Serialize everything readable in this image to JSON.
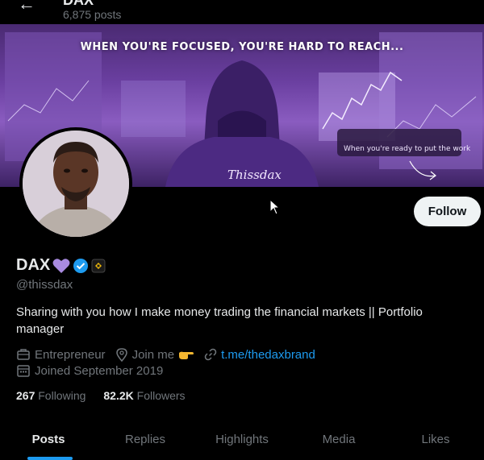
{
  "header": {
    "name": "DAX",
    "posts_count": "6,875 posts"
  },
  "banner": {
    "quote": "WHEN YOU'RE FOCUSED, YOU'RE HARD TO REACH...",
    "note": "When you're ready to put the work",
    "signature": "Thissdax"
  },
  "follow_label": "Follow",
  "profile": {
    "display_name": "DAX",
    "handle": "@thissdax",
    "bio": "Sharing with you how I make money trading the financial markets || Portfolio manager",
    "occupation": "Entrepreneur",
    "location": "Join me",
    "link": "t.me/thedaxbrand",
    "joined": "Joined September 2019"
  },
  "stats": {
    "following_count": "267",
    "following_label": "Following",
    "followers_count": "82.2K",
    "followers_label": "Followers"
  },
  "tabs": [
    "Posts",
    "Replies",
    "Highlights",
    "Media",
    "Likes"
  ],
  "colors": {
    "accent": "#1d9bf0",
    "background": "#000000",
    "muted_text": "#71767b",
    "verified": "#1d9bf0",
    "heart": "#a98be0"
  }
}
